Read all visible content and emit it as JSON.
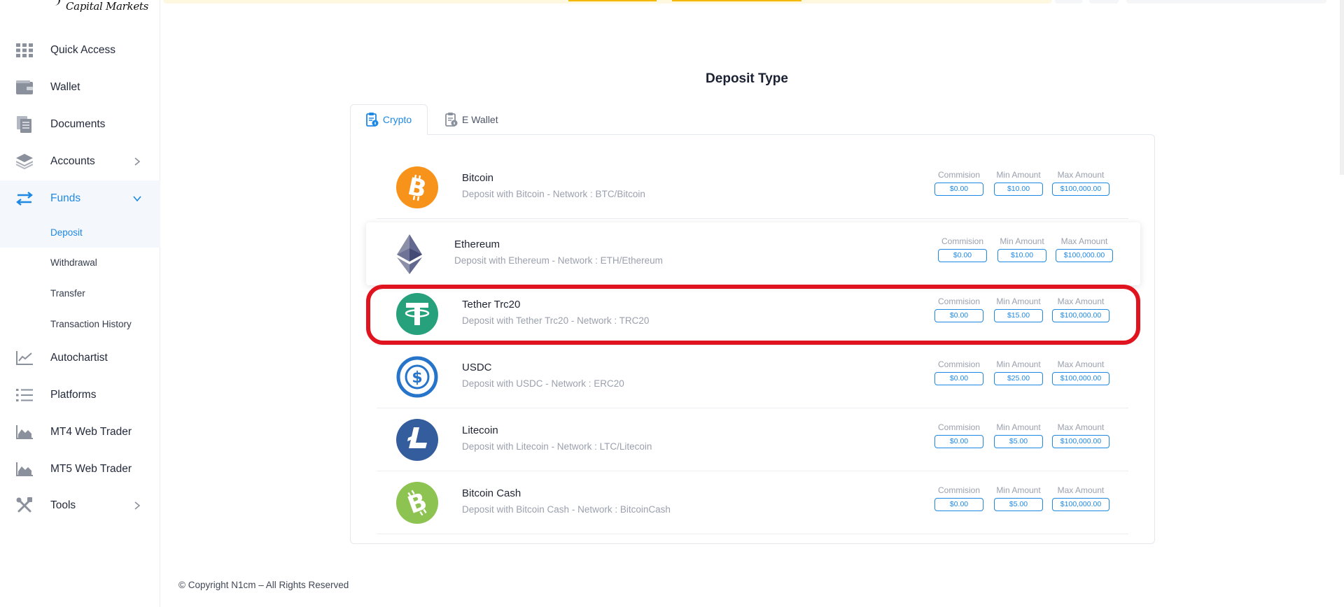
{
  "brand": {
    "logo_text": "Capital Markets"
  },
  "sidebar": {
    "items": [
      {
        "label": "Quick Access",
        "icon": "grid-icon"
      },
      {
        "label": "Wallet",
        "icon": "wallet-icon"
      },
      {
        "label": "Documents",
        "icon": "documents-icon"
      },
      {
        "label": "Accounts",
        "icon": "layers-icon"
      },
      {
        "label": "Funds",
        "icon": "transfer-arrows-icon"
      },
      {
        "label": "Autochartist",
        "icon": "chart-line-icon"
      },
      {
        "label": "Platforms",
        "icon": "list-icon"
      },
      {
        "label": "MT4 Web Trader",
        "icon": "area-chart-icon"
      },
      {
        "label": "MT5 Web Trader",
        "icon": "area-chart-icon"
      },
      {
        "label": "Tools",
        "icon": "tools-icon"
      }
    ],
    "funds_sub": [
      {
        "label": "Deposit"
      },
      {
        "label": "Withdrawal"
      },
      {
        "label": "Transfer"
      },
      {
        "label": "Transaction History"
      }
    ]
  },
  "main": {
    "title": "Deposit Type",
    "tabs": [
      {
        "label": "Crypto"
      },
      {
        "label": "E Wallet"
      }
    ],
    "stat_labels": {
      "commission": "Commision",
      "min": "Min Amount",
      "max": "Max Amount"
    },
    "methods": [
      {
        "name": "Bitcoin",
        "desc": "Deposit with Bitcoin - Network : BTC/Bitcoin",
        "commission": "$0.00",
        "min": "$10.00",
        "max": "$100,000.00",
        "icon": "bitcoin-icon",
        "color": "#f7931a"
      },
      {
        "name": "Ethereum",
        "desc": "Deposit with Ethereum - Network : ETH/Ethereum",
        "commission": "$0.00",
        "min": "$10.00",
        "max": "$100,000.00",
        "icon": "ethereum-icon",
        "color": "#62688f"
      },
      {
        "name": "Tether Trc20",
        "desc": "Deposit with Tether Trc20 - Network : TRC20",
        "commission": "$0.00",
        "min": "$15.00",
        "max": "$100,000.00",
        "icon": "tether-icon",
        "color": "#26a17b"
      },
      {
        "name": "USDC",
        "desc": "Deposit with USDC - Network : ERC20",
        "commission": "$0.00",
        "min": "$25.00",
        "max": "$100,000.00",
        "icon": "usdc-icon",
        "color": "#2775ca"
      },
      {
        "name": "Litecoin",
        "desc": "Deposit with Litecoin - Network : LTC/Litecoin",
        "commission": "$0.00",
        "min": "$5.00",
        "max": "$100,000.00",
        "icon": "litecoin-icon",
        "color": "#345d9d"
      },
      {
        "name": "Bitcoin Cash",
        "desc": "Deposit with Bitcoin Cash - Network : BitcoinCash",
        "commission": "$0.00",
        "min": "$5.00",
        "max": "$100,000.00",
        "icon": "bitcoin-cash-icon",
        "color": "#8dc351"
      }
    ]
  },
  "footer": {
    "copyright": "© Copyright N1cm – All Rights Reserved"
  },
  "colors": {
    "accent": "#1e88e5",
    "highlight": "#e0141e"
  }
}
